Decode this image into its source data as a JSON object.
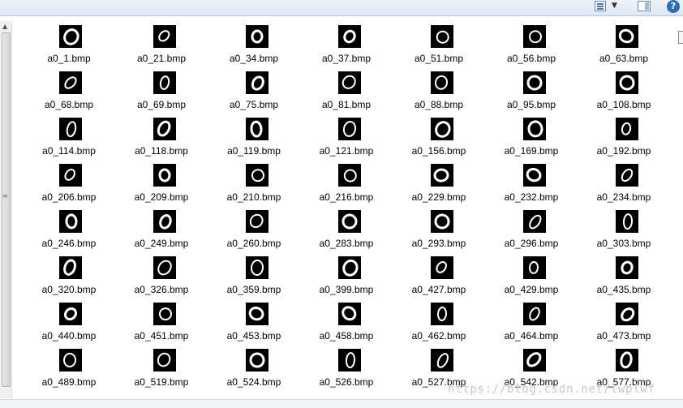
{
  "toolbar": {
    "view_icon": "view-options-icon",
    "caret_icon": "chevron-down-icon",
    "preview_icon": "preview-pane-icon",
    "help_label": "?"
  },
  "scrollbar": {
    "up_glyph": "▲",
    "grip_glyph": "≡"
  },
  "files": [
    "a0_1.bmp",
    "a0_21.bmp",
    "a0_34.bmp",
    "a0_37.bmp",
    "a0_51.bmp",
    "a0_56.bmp",
    "a0_63.bmp",
    "a0_68.bmp",
    "a0_69.bmp",
    "a0_75.bmp",
    "a0_81.bmp",
    "a0_88.bmp",
    "a0_95.bmp",
    "a0_108.bmp",
    "a0_114.bmp",
    "a0_118.bmp",
    "a0_119.bmp",
    "a0_121.bmp",
    "a0_156.bmp",
    "a0_169.bmp",
    "a0_192.bmp",
    "a0_206.bmp",
    "a0_209.bmp",
    "a0_210.bmp",
    "a0_216.bmp",
    "a0_229.bmp",
    "a0_232.bmp",
    "a0_234.bmp",
    "a0_246.bmp",
    "a0_249.bmp",
    "a0_260.bmp",
    "a0_283.bmp",
    "a0_293.bmp",
    "a0_296.bmp",
    "a0_303.bmp",
    "a0_320.bmp",
    "a0_326.bmp",
    "a0_359.bmp",
    "a0_399.bmp",
    "a0_427.bmp",
    "a0_429.bmp",
    "a0_435.bmp",
    "a0_440.bmp",
    "a0_451.bmp",
    "a0_453.bmp",
    "a0_458.bmp",
    "a0_462.bmp",
    "a0_464.bmp",
    "a0_473.bmp",
    "a0_489.bmp",
    "a0_519.bmp",
    "a0_524.bmp",
    "a0_526.bmp",
    "a0_527.bmp",
    "a0_542.bmp",
    "a0_577.bmp"
  ],
  "status": {
    "text": ""
  },
  "watermark": "https://blog.csdn.net/lwplwf"
}
